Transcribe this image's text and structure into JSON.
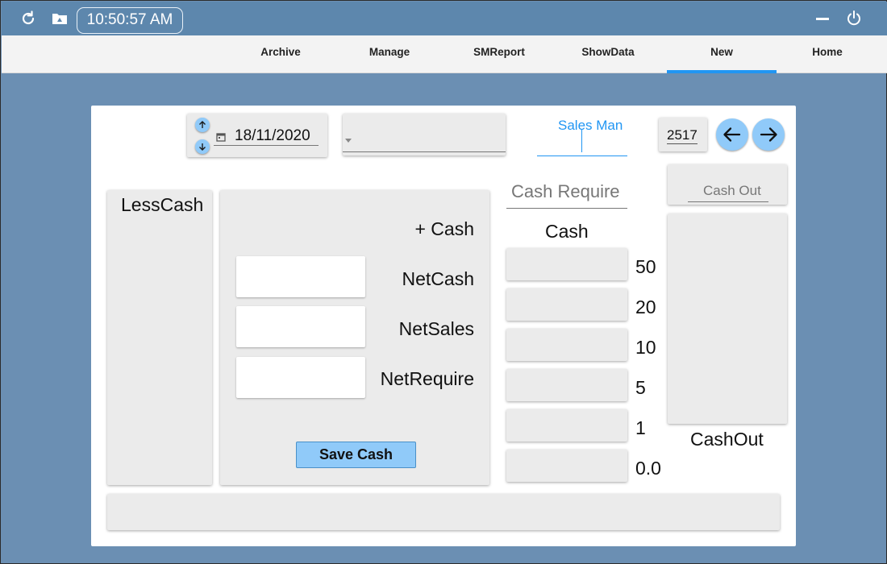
{
  "topbar": {
    "time": "10:50:57 AM",
    "icons": [
      "refresh-icon",
      "folder-icon",
      "minimize-icon",
      "power-icon"
    ]
  },
  "nav": {
    "tabs": [
      {
        "label": "Archive",
        "name": "tab-archive"
      },
      {
        "label": "Manage",
        "name": "tab-manage"
      },
      {
        "label": "SMReport",
        "name": "tab-smreport"
      },
      {
        "label": "ShowData",
        "name": "tab-showdata"
      },
      {
        "label": "New",
        "name": "tab-new",
        "active": true
      },
      {
        "label": "Home",
        "name": "tab-home"
      }
    ]
  },
  "form": {
    "date": "18/11/2020",
    "combo_value": "",
    "salesman_label": "Sales Man",
    "record_number": "2517"
  },
  "left": {
    "lesscash_label": "LessCash"
  },
  "center": {
    "plus_cash_label": "+ Cash",
    "netcash_label": "NetCash",
    "netsales_label": "NetSales",
    "netrequire_label": "NetRequire",
    "save_button": "Save Cash"
  },
  "cash": {
    "require_placeholder": "Cash Require",
    "header": "Cash",
    "denominations": [
      "50",
      "20",
      "10",
      "5",
      "1",
      "0.0"
    ]
  },
  "cashout": {
    "placeholder": "Cash Out",
    "label": "CashOut"
  },
  "colors": {
    "background": "#6b8fb3",
    "topbar": "#5d87ad",
    "accent": "#2196f3",
    "round_button": "#90caf9",
    "panel": "#ebebeb"
  }
}
